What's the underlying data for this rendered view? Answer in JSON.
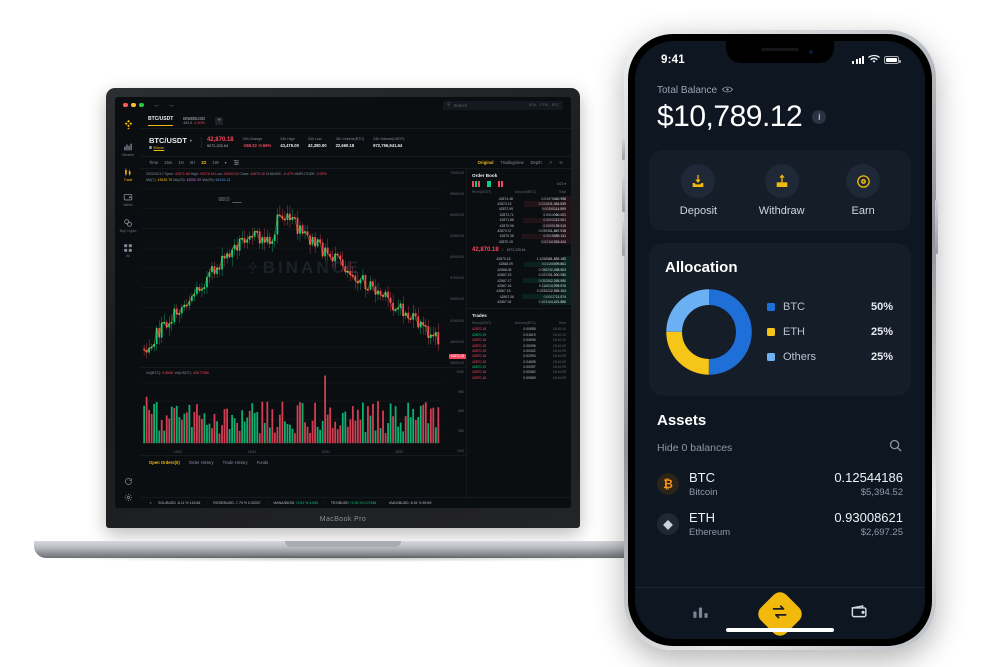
{
  "laptop": {
    "model_label": "MacBook Pro",
    "browser": {
      "back_icon": "arrow-left-icon",
      "forward_icon": "arrow-right-icon"
    },
    "search": {
      "placeholder": "Search",
      "tags": [
        "ADA",
        "FTM",
        "BTC"
      ]
    },
    "sidebar": {
      "logo": "binance-logo",
      "items": [
        {
          "label": "Markets",
          "icon": "bar-chart-icon",
          "active": false
        },
        {
          "label": "Trade",
          "icon": "candles-icon",
          "active": true
        },
        {
          "label": "Wallet",
          "icon": "wallet-icon",
          "active": false
        },
        {
          "label": "Buy Crypto",
          "icon": "coins-icon",
          "active": false
        },
        {
          "label": "All",
          "icon": "grid-icon",
          "active": false
        }
      ],
      "bottom": [
        {
          "label": "refresh-icon"
        },
        {
          "label": "settings-icon"
        }
      ]
    },
    "pair_tabs": [
      {
        "label": "BTC/USDT",
        "active": true
      },
      {
        "label": "BNB/BUSD",
        "price": "484.6",
        "change": "-2.40%",
        "active": false
      }
    ],
    "add_tab": "+",
    "ticker_stats": {
      "pair": "BTC/USDT",
      "pair_sub": "Bitcoin",
      "last_price": "42,870.18",
      "last_price_fiat": "¥272,225.64",
      "columns": [
        {
          "label": "24h Change",
          "value": "-286.32 -0.66%",
          "down": true
        },
        {
          "label": "24h High",
          "value": "43,475.00",
          "down": false
        },
        {
          "label": "24h Low",
          "value": "42,380.00",
          "down": false
        },
        {
          "label": "24h Volume(BTC)",
          "value": "22,660.18",
          "down": false
        },
        {
          "label": "24h Volume(USDT)",
          "value": "972,756,941.64",
          "down": false
        }
      ]
    },
    "chart_toolbar": {
      "left": [
        "Time",
        "15m",
        "1H",
        "4H",
        "1D",
        "1W"
      ],
      "active": "1D",
      "dropdown_icon": "chevron-down-icon",
      "indicator_icon": "indicators-icon",
      "right": [
        "Original",
        "TradingView",
        "Depth"
      ],
      "right_active": "Original",
      "fullscreen_icon": "expand-icon",
      "camera_icon": "screenshot-icon"
    },
    "ohlc": {
      "date": "2022/01/17",
      "open_label": "Open:",
      "open": "43071.66",
      "high_label": "High:",
      "high": "43176.18",
      "low_label": "Low:",
      "low": "42300.03",
      "close_label": "Close:",
      "close": "42870.18",
      "change_label": "CHANGE:",
      "change": "-0.47%",
      "amplitude_label": "AMPLITUDE:",
      "amplitude": "2.03%",
      "ma_label": "MA(7):",
      "ma7": "43839.76",
      "ma25_label": "MA(25):",
      "ma25": "48282.99",
      "ma99_label": "MA(99):",
      "ma99": "54216.13"
    },
    "watermark": "BINANCE",
    "price_axis": [
      "72000.00",
      "69000.00",
      "66000.00",
      "63000.00",
      "60000.00",
      "57000.00",
      "54000.00",
      "51000.00",
      "48000.00",
      "45000.00"
    ],
    "price_tag_high": "69000.00",
    "last_price_tag": "42870.18",
    "volume": {
      "vol_btc_label": "Vol(BTC):",
      "vol_btc": "9.584K",
      "vol_usdt_label": "Vol(USDT):",
      "vol_usdt": "408.776M",
      "axis": [
        "120K",
        "90K",
        "60K",
        "30K",
        "0.00"
      ]
    },
    "x_axis": [
      "10/01",
      "11/01",
      "12/01",
      "2022"
    ],
    "order_tabs": [
      {
        "label": "Open Orders(0)",
        "active": true
      },
      {
        "label": "Order History",
        "active": false
      },
      {
        "label": "Trade History",
        "active": false
      },
      {
        "label": "Funds",
        "active": false
      }
    ],
    "order_book": {
      "title": "Order Book",
      "step": "0.01",
      "headers": [
        "Price(USDT)",
        "Amount(BTC)",
        "Total"
      ],
      "asks": [
        {
          "price": "42874.48",
          "amount": "0.01075",
          "total": "440.958"
        },
        {
          "price": "42873.13",
          "amount": "0.02483",
          "total": "1,064.539"
        },
        {
          "price": "42872.99",
          "amount": "0.00358",
          "total": "114.899"
        },
        {
          "price": "42872.71",
          "amount": "0.00140",
          "total": "60.021"
        },
        {
          "price": "42871.86",
          "amount": "0.00020",
          "total": "12.001"
        },
        {
          "price": "42870.96",
          "amount": "0.00091",
          "total": "39.010"
        },
        {
          "price": "42870.37",
          "amount": "0.03936",
          "total": "1,687.918"
        },
        {
          "price": "42870.36",
          "amount": "0.00188",
          "total": "89.141"
        },
        {
          "price": "42870.19",
          "amount": "0.02161",
          "total": "926.424"
        }
      ],
      "mid_price": "42,870.18",
      "mid_arrow": "↓",
      "mid_fiat": "¥272,225.64",
      "bids": [
        {
          "price": "42870.18",
          "amount": "1.42585",
          "total": "61,892.150"
        },
        {
          "price": "42868.09",
          "amount": "0.01166",
          "total": "499.861"
        },
        {
          "price": "42868.08",
          "amount": "0.05829",
          "total": "2,498.903"
        },
        {
          "price": "42867.23",
          "amount": "0.02235",
          "total": "1,000.050"
        },
        {
          "price": "42867.17",
          "amount": "0.05286",
          "total": "2,265.950"
        },
        {
          "price": "42867.16",
          "amount": "0.11663",
          "total": "4,999.576"
        },
        {
          "price": "42867.15",
          "amount": "0.29382",
          "total": "12,595.204"
        },
        {
          "price": "42867.06",
          "amount": "0.00027",
          "total": "11.574"
        },
        {
          "price": "42867.04",
          "amount": "0.10316",
          "total": "4,421.886"
        }
      ]
    },
    "trades": {
      "title": "Trades",
      "headers": [
        "Price(USDT)",
        "Amount(BTC)",
        "Time"
      ],
      "rows": [
        {
          "price": "42870.18",
          "amount": "0.00898",
          "time": "18:10:10",
          "side": "sell"
        },
        {
          "price": "42870.19",
          "amount": "0.01619",
          "time": "18:10:10",
          "side": "buy"
        },
        {
          "price": "42870.18",
          "amount": "0.00696",
          "time": "18:10:10",
          "side": "sell"
        },
        {
          "price": "42870.18",
          "amount": "0.00096",
          "time": "18:10:09",
          "side": "sell"
        },
        {
          "price": "42870.18",
          "amount": "0.00402",
          "time": "18:10:09",
          "side": "sell"
        },
        {
          "price": "42870.18",
          "amount": "0.02994",
          "time": "18:10:09",
          "side": "sell"
        },
        {
          "price": "42870.18",
          "amount": "0.04655",
          "time": "18:10:09",
          "side": "sell"
        },
        {
          "price": "42870.19",
          "amount": "0.00097",
          "time": "18:10:09",
          "side": "buy"
        },
        {
          "price": "42870.18",
          "amount": "0.00562",
          "time": "18:10:09",
          "side": "sell"
        },
        {
          "price": "42870.18",
          "amount": "0.00569",
          "time": "18:10:09",
          "side": "sell"
        }
      ]
    },
    "bottom_ticker": [
      {
        "symbol": "SOL/BUSD",
        "change": "-6.11 %",
        "price": "143.66",
        "dir": "down"
      },
      {
        "symbol": "ROSE/BUSD",
        "change": "-7.79 %",
        "price": "0.32037",
        "dir": "down"
      },
      {
        "symbol": "MANA/BUSD",
        "change": "+2.51 %",
        "price": "3.053",
        "dir": "up"
      },
      {
        "symbol": "TRX/BUSD",
        "change": "+2.00 %",
        "price": "0.07156",
        "dir": "up"
      },
      {
        "symbol": "AVAX/BUSD",
        "change": "-6.51 %",
        "price": "89.69",
        "dir": "down"
      }
    ]
  },
  "phone": {
    "status": {
      "time": "9:41",
      "signal_icon": "cellular-bars-icon",
      "wifi_icon": "wifi-icon",
      "battery_icon": "battery-icon"
    },
    "balance": {
      "label": "Total Balance",
      "eye_icon": "eye-icon",
      "value": "$10,789.12",
      "info_icon": "info-icon",
      "info_char": "i"
    },
    "actions": [
      {
        "label": "Deposit",
        "icon": "deposit-arrow-down-icon"
      },
      {
        "label": "Withdraw",
        "icon": "withdraw-arrow-up-icon"
      },
      {
        "label": "Earn",
        "icon": "earn-coin-icon"
      }
    ],
    "allocation": {
      "title": "Allocation"
    },
    "assets": {
      "title": "Assets",
      "hide_label": "Hide 0 balances",
      "search_icon": "search-icon",
      "rows": [
        {
          "symbol": "BTC",
          "name": "Bitcoin",
          "amount": "0.12544186",
          "fiat": "$5,394.52",
          "glyph": "₿"
        },
        {
          "symbol": "ETH",
          "name": "Ethereum",
          "amount": "0.93008621",
          "fiat": "$2,697.25",
          "glyph": "◆"
        }
      ]
    },
    "tabbar": [
      {
        "icon": "chart-bars-icon",
        "name": "markets-tab"
      },
      {
        "icon": "swap-arrows-icon",
        "name": "swap-tab"
      },
      {
        "icon": "wallet-icon",
        "name": "wallet-tab"
      }
    ]
  },
  "chart_data": {
    "type": "pie",
    "title": "Allocation",
    "labels": [
      "BTC",
      "ETH",
      "Others"
    ],
    "values": [
      50,
      25,
      25
    ],
    "value_labels": [
      "50%",
      "25%",
      "25%"
    ],
    "colors": [
      "#1f6fd8",
      "#f5c518",
      "#6ab0f3"
    ],
    "legend_position": "right",
    "donut": true
  }
}
